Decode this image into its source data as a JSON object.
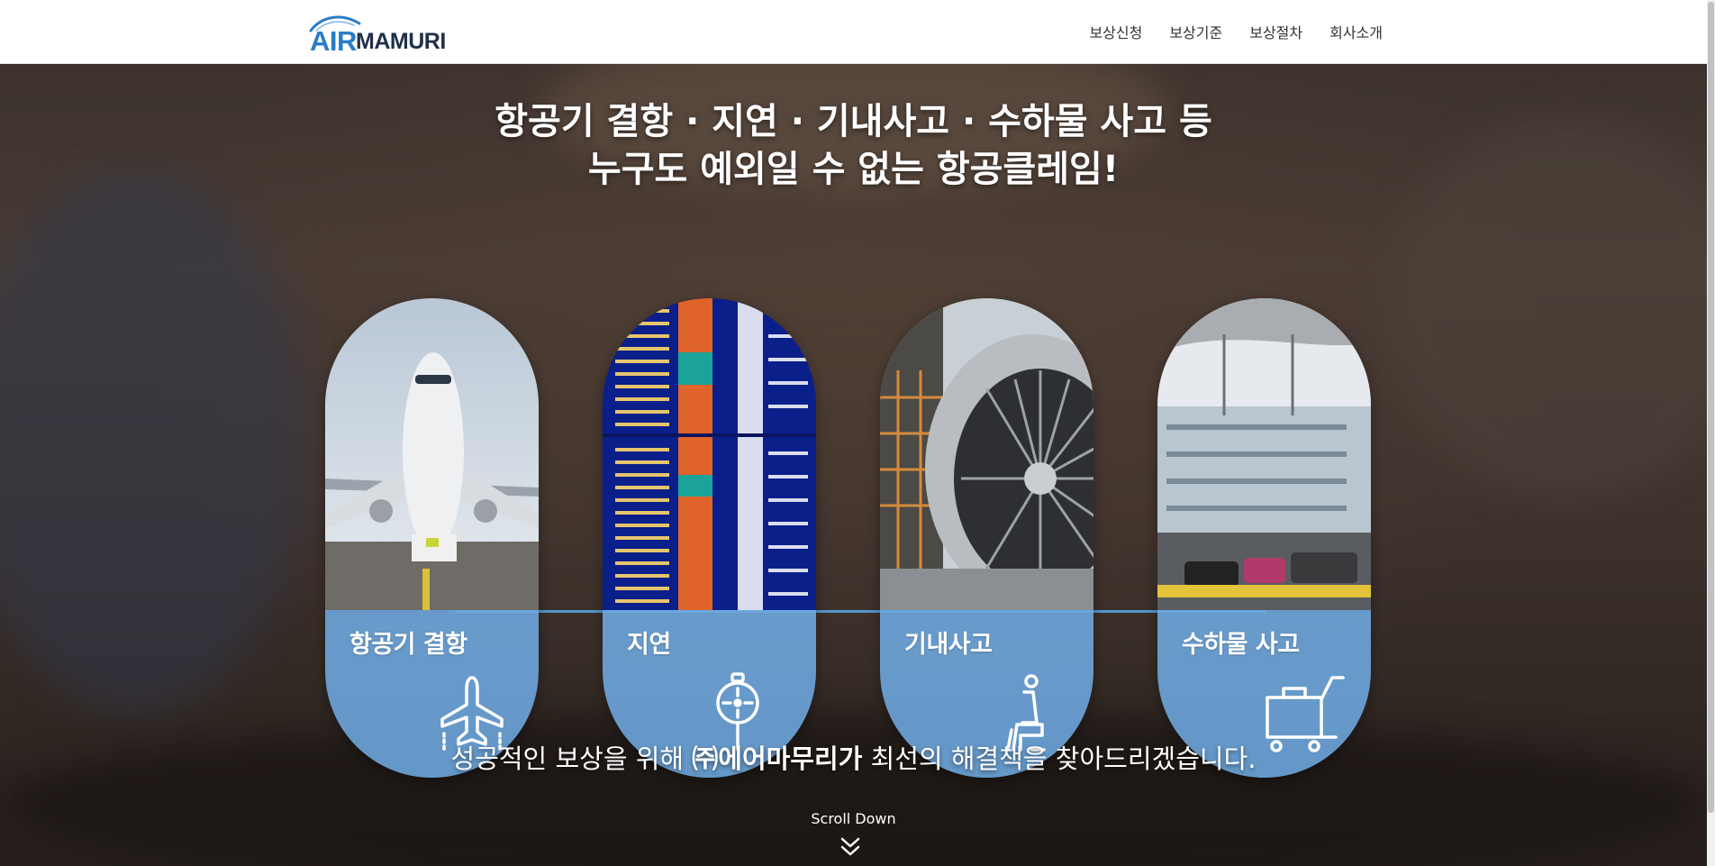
{
  "header": {
    "logo": {
      "air": "AIR",
      "mamuri": "MAMURI"
    },
    "nav": [
      {
        "label": "보상신청"
      },
      {
        "label": "보상기준"
      },
      {
        "label": "보상절차"
      },
      {
        "label": "회사소개"
      }
    ]
  },
  "hero": {
    "headline_line1": "항공기 결항 · 지연 · 기내사고 · 수하물 사고 등",
    "headline_line2": "누구도 예외일 수 없는 항공클레임!",
    "cards": [
      {
        "label": "항공기 결항",
        "icon": "airplane-icon"
      },
      {
        "label": "지연",
        "icon": "stopwatch-icon"
      },
      {
        "label": "기내사고",
        "icon": "seat-icon"
      },
      {
        "label": "수하물 사고",
        "icon": "luggage-cart-icon"
      }
    ],
    "tagline_pre": "성공적인 보상을 위해 ",
    "tagline_bold": "㈜에어마무리가",
    "tagline_post": " 최선의 해결책을 찾아드리겠습니다.",
    "scroll_down": "Scroll Down"
  },
  "colors": {
    "brand_blue": "#2a7cc7",
    "panel_blue": "#6eaae1",
    "line_blue": "#5aa8e6"
  }
}
